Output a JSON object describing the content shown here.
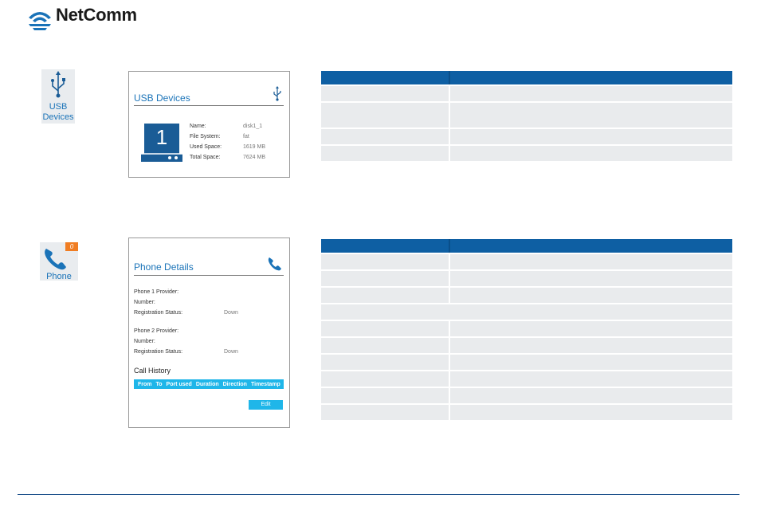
{
  "brand": {
    "name": "NetComm"
  },
  "usb_tile": {
    "label": "USB\nDevices"
  },
  "usb_card": {
    "title": "USB Devices",
    "disk_number": "1",
    "fields": [
      {
        "label": "Name:",
        "value": "disk1_1"
      },
      {
        "label": "File System:",
        "value": "fat"
      },
      {
        "label": "Used Space:",
        "value": "1619 MB"
      },
      {
        "label": "Total Space:",
        "value": "7624 MB"
      }
    ]
  },
  "usb_table": {
    "row_heights": [
      17,
      19,
      31,
      19,
      19
    ]
  },
  "phone_tile": {
    "label": "Phone",
    "badge": "0"
  },
  "phone_card": {
    "title": "Phone Details",
    "phone1": [
      {
        "label": "Phone 1 Provider:",
        "value": ""
      },
      {
        "label": "Number:",
        "value": ""
      },
      {
        "label": "Registration Status:",
        "value": "Down"
      }
    ],
    "phone2": [
      {
        "label": "Phone 2 Provider:",
        "value": ""
      },
      {
        "label": "Number:",
        "value": ""
      },
      {
        "label": "Registration Status:",
        "value": "Down"
      }
    ],
    "call_history_title": "Call History",
    "call_columns": [
      "From",
      "To",
      "Port used",
      "Duration",
      "Direction",
      "Timestamp"
    ],
    "edit_label": "Edit"
  },
  "colors": {
    "brand_blue": "#0e5fa3",
    "accent_cyan": "#1fb6e9",
    "badge_orange": "#f07d23"
  }
}
